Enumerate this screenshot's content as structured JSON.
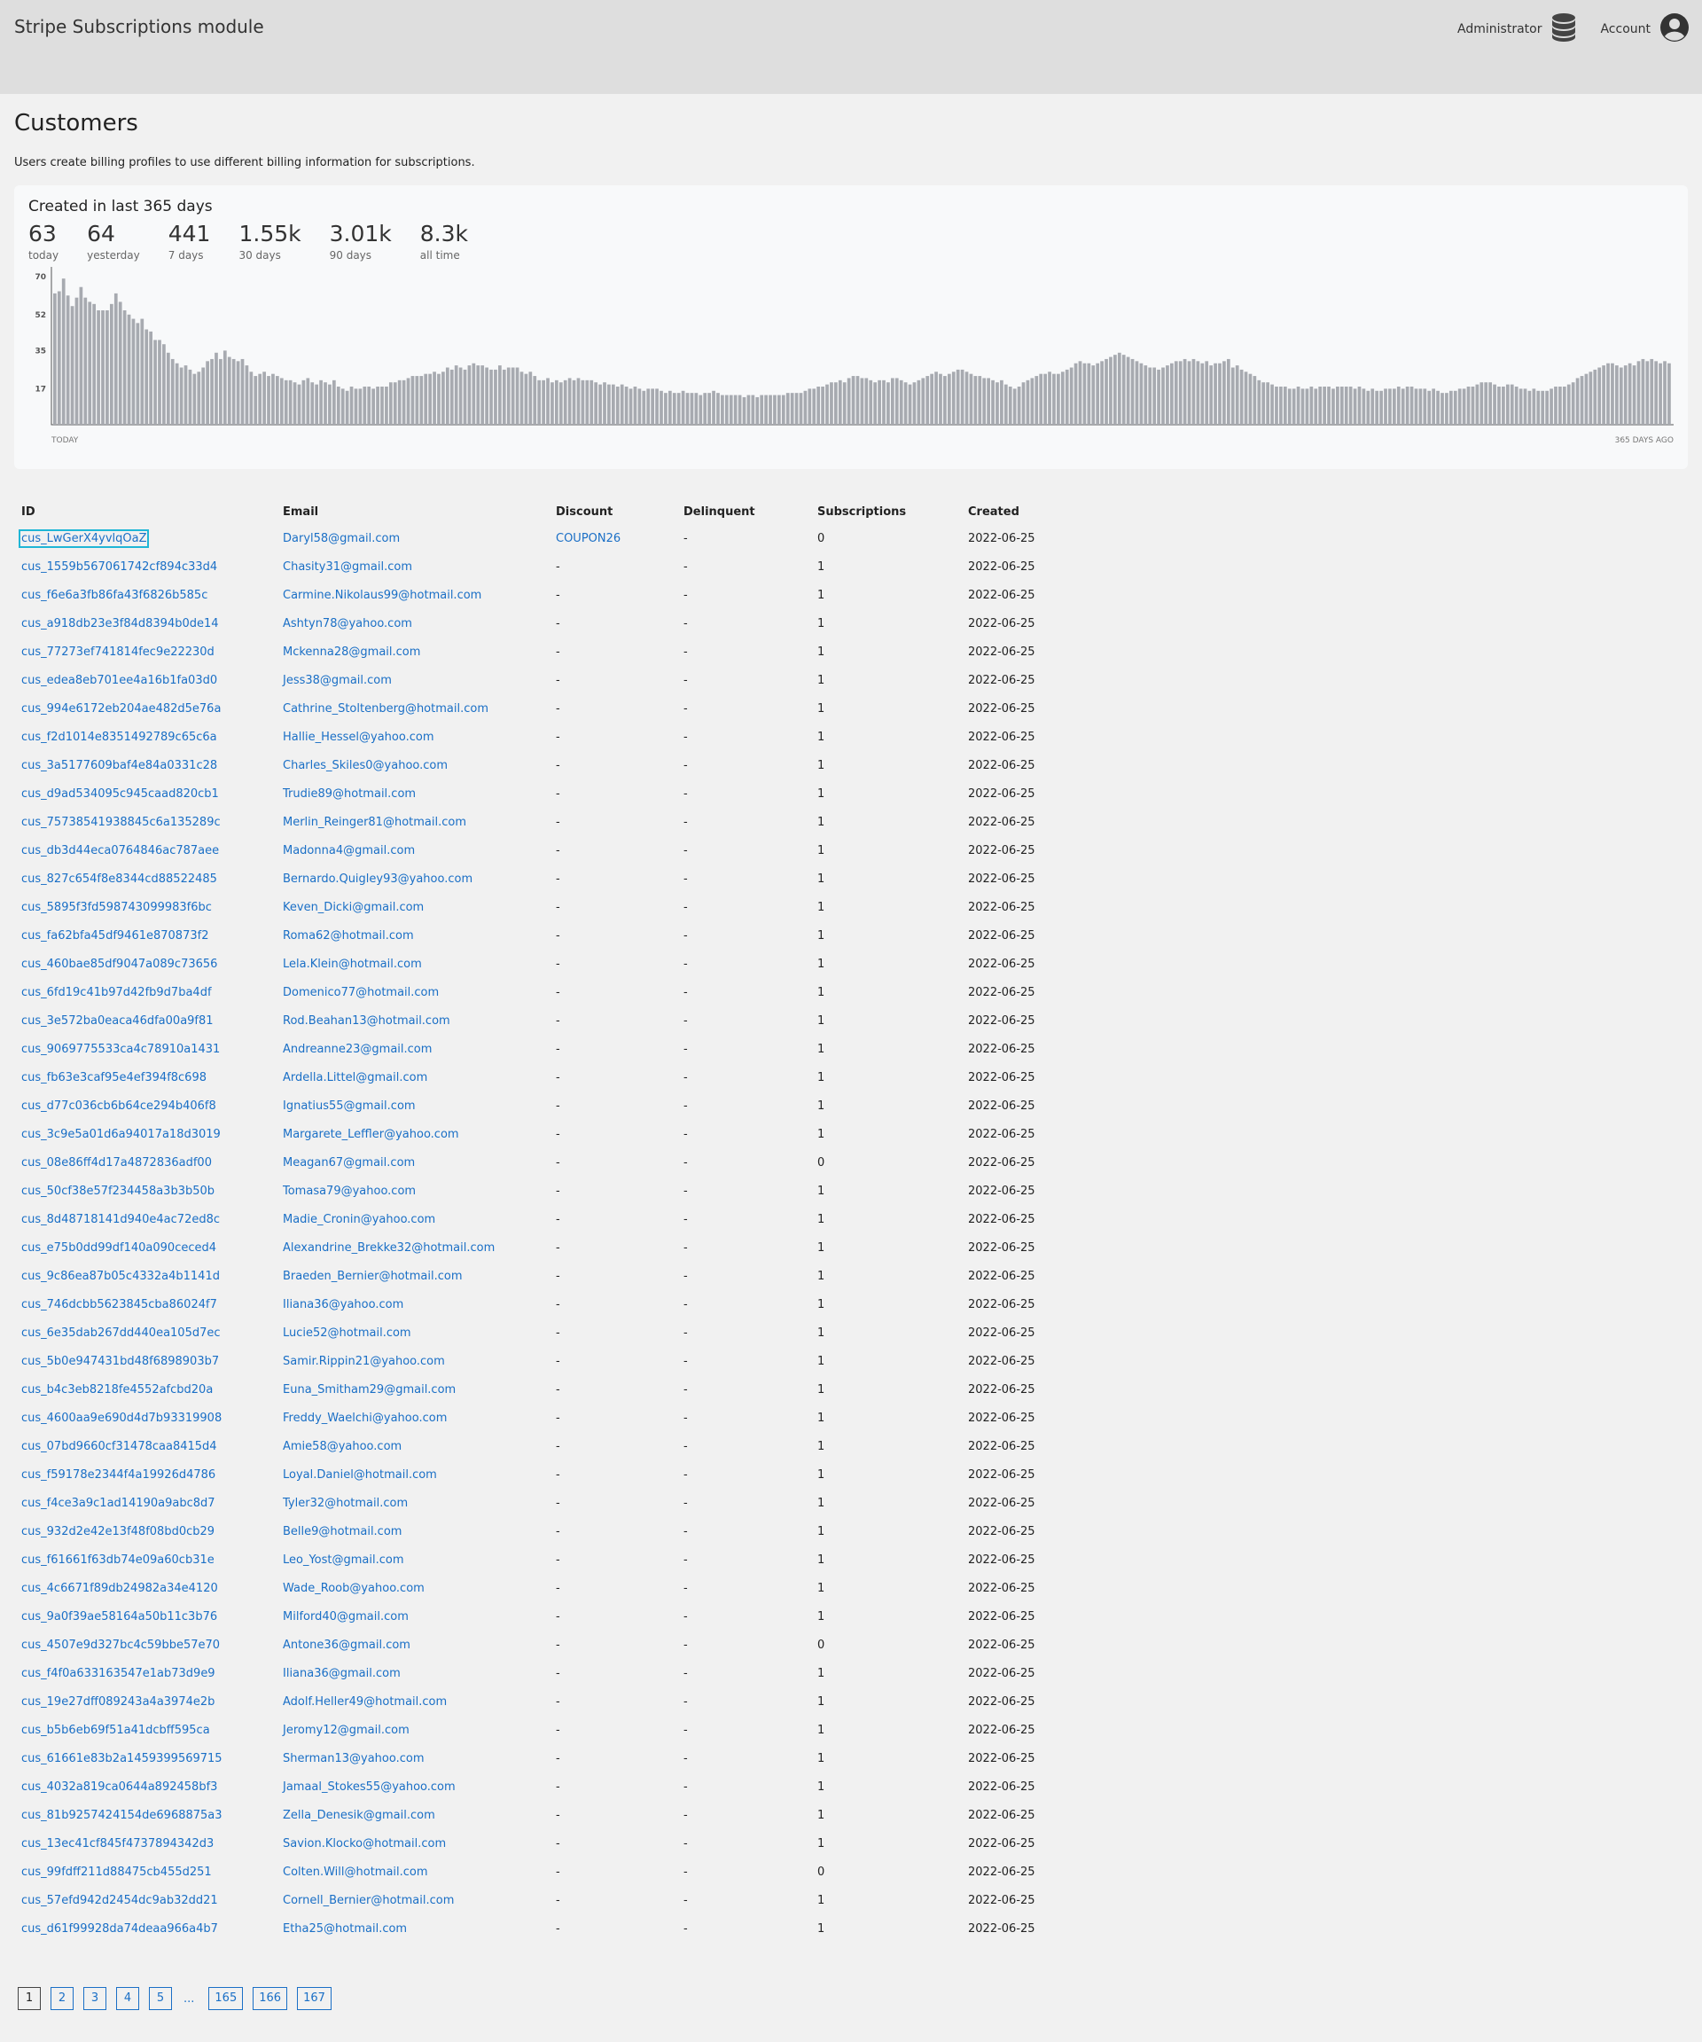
{
  "header": {
    "title": "Stripe Subscriptions module",
    "admin_label": "Administrator",
    "admin_icon": "database-icon",
    "account_label": "Account",
    "account_icon": "user-circle-icon"
  },
  "page": {
    "title": "Customers",
    "description": "Users create billing profiles to use different billing information for subscriptions."
  },
  "stats_card": {
    "title": "Created in last 365 days",
    "stats": [
      {
        "value": "63",
        "label": "today"
      },
      {
        "value": "64",
        "label": "yesterday"
      },
      {
        "value": "441",
        "label": "7 days"
      },
      {
        "value": "1.55k",
        "label": "30 days"
      },
      {
        "value": "3.01k",
        "label": "90 days"
      },
      {
        "value": "8.3k",
        "label": "all time"
      }
    ]
  },
  "chart_data": {
    "type": "bar",
    "title": "",
    "xlabel": "",
    "ylabel": "",
    "x_start_label": "TODAY",
    "x_end_label": "365 DAYS AGO",
    "y_ticks": [
      70,
      52,
      35,
      17
    ],
    "ylim": [
      0,
      72
    ],
    "bar_color": "#a7aab0",
    "values": [
      62,
      63,
      69,
      61,
      56,
      60,
      65,
      60,
      58,
      57,
      54,
      54,
      54,
      57,
      62,
      58,
      54,
      52,
      50,
      48,
      50,
      45,
      44,
      40,
      40,
      38,
      34,
      31,
      29,
      27,
      28,
      26,
      24,
      25,
      27,
      30,
      31,
      34,
      31,
      35,
      32,
      31,
      30,
      31,
      28,
      25,
      23,
      24,
      25,
      23,
      24,
      23,
      22,
      21,
      21,
      20,
      19,
      21,
      22,
      20,
      19,
      21,
      20,
      19,
      21,
      18,
      17,
      16,
      18,
      17,
      17,
      18,
      18,
      17,
      18,
      18,
      18,
      20,
      20,
      21,
      21,
      22,
      23,
      23,
      23,
      24,
      24,
      25,
      24,
      25,
      27,
      26,
      28,
      27,
      26,
      28,
      29,
      28,
      28,
      27,
      26,
      26,
      28,
      26,
      27,
      27,
      27,
      25,
      24,
      25,
      23,
      21,
      21,
      22,
      20,
      21,
      20,
      21,
      22,
      21,
      22,
      21,
      21,
      21,
      20,
      19,
      20,
      19,
      19,
      18,
      19,
      18,
      17,
      18,
      17,
      16,
      17,
      17,
      17,
      16,
      15,
      16,
      15,
      15,
      16,
      15,
      15,
      15,
      14,
      15,
      15,
      16,
      15,
      14,
      14,
      14,
      14,
      14,
      13,
      14,
      14,
      13,
      14,
      14,
      14,
      14,
      14,
      14,
      15,
      15,
      15,
      15,
      16,
      17,
      17,
      18,
      18,
      19,
      20,
      20,
      21,
      20,
      22,
      23,
      23,
      22,
      22,
      21,
      20,
      21,
      21,
      20,
      22,
      22,
      21,
      20,
      19,
      20,
      21,
      22,
      23,
      24,
      25,
      24,
      23,
      24,
      25,
      26,
      26,
      25,
      24,
      23,
      23,
      22,
      22,
      21,
      20,
      21,
      19,
      18,
      17,
      18,
      20,
      21,
      22,
      23,
      24,
      24,
      25,
      24,
      24,
      25,
      26,
      27,
      29,
      30,
      29,
      29,
      28,
      29,
      30,
      31,
      32,
      33,
      34,
      33,
      32,
      31,
      30,
      29,
      28,
      27,
      27,
      26,
      27,
      28,
      29,
      30,
      30,
      31,
      30,
      31,
      30,
      29,
      30,
      28,
      29,
      29,
      30,
      31,
      27,
      28,
      26,
      25,
      24,
      23,
      21,
      20,
      20,
      19,
      18,
      18,
      18,
      17,
      17,
      18,
      17,
      17,
      18,
      17,
      18,
      18,
      18,
      17,
      18,
      18,
      18,
      18,
      17,
      18,
      17,
      16,
      17,
      16,
      16,
      17,
      17,
      17,
      18,
      17,
      18,
      18,
      17,
      17,
      17,
      16,
      17,
      16,
      15,
      15,
      16,
      16,
      17,
      17,
      18,
      18,
      19,
      20,
      20,
      20,
      19,
      18,
      18,
      19,
      19,
      18,
      17,
      17,
      16,
      17,
      16,
      16,
      16,
      17,
      18,
      18,
      18,
      19,
      20,
      22,
      23,
      24,
      25,
      26,
      27,
      28,
      29,
      29,
      28,
      27,
      28,
      29,
      28,
      30,
      31,
      30,
      31,
      30,
      29,
      30,
      29
    ]
  },
  "table": {
    "columns": [
      "ID",
      "Email",
      "Discount",
      "Delinquent",
      "Subscriptions",
      "Created"
    ],
    "rows": [
      [
        "cus_LwGerX4yvlqOaZ",
        "Daryl58@gmail.com",
        "COUPON26",
        "-",
        "0",
        "2022-06-25"
      ],
      [
        "cus_1559b567061742cf894c33d4",
        "Chasity31@gmail.com",
        "-",
        "-",
        "1",
        "2022-06-25"
      ],
      [
        "cus_f6e6a3fb86fa43f6826b585c",
        "Carmine.Nikolaus99@hotmail.com",
        "-",
        "-",
        "1",
        "2022-06-25"
      ],
      [
        "cus_a918db23e3f84d8394b0de14",
        "Ashtyn78@yahoo.com",
        "-",
        "-",
        "1",
        "2022-06-25"
      ],
      [
        "cus_77273ef741814fec9e22230d",
        "Mckenna28@gmail.com",
        "-",
        "-",
        "1",
        "2022-06-25"
      ],
      [
        "cus_edea8eb701ee4a16b1fa03d0",
        "Jess38@gmail.com",
        "-",
        "-",
        "1",
        "2022-06-25"
      ],
      [
        "cus_994e6172eb204ae482d5e76a",
        "Cathrine_Stoltenberg@hotmail.com",
        "-",
        "-",
        "1",
        "2022-06-25"
      ],
      [
        "cus_f2d1014e8351492789c65c6a",
        "Hallie_Hessel@yahoo.com",
        "-",
        "-",
        "1",
        "2022-06-25"
      ],
      [
        "cus_3a5177609baf4e84a0331c28",
        "Charles_Skiles0@yahoo.com",
        "-",
        "-",
        "1",
        "2022-06-25"
      ],
      [
        "cus_d9ad534095c945caad820cb1",
        "Trudie89@hotmail.com",
        "-",
        "-",
        "1",
        "2022-06-25"
      ],
      [
        "cus_75738541938845c6a135289c",
        "Merlin_Reinger81@hotmail.com",
        "-",
        "-",
        "1",
        "2022-06-25"
      ],
      [
        "cus_db3d44eca0764846ac787aee",
        "Madonna4@gmail.com",
        "-",
        "-",
        "1",
        "2022-06-25"
      ],
      [
        "cus_827c654f8e8344cd88522485",
        "Bernardo.Quigley93@yahoo.com",
        "-",
        "-",
        "1",
        "2022-06-25"
      ],
      [
        "cus_5895f3fd598743099983f6bc",
        "Keven_Dicki@gmail.com",
        "-",
        "-",
        "1",
        "2022-06-25"
      ],
      [
        "cus_fa62bfa45df9461e870873f2",
        "Roma62@hotmail.com",
        "-",
        "-",
        "1",
        "2022-06-25"
      ],
      [
        "cus_460bae85df9047a089c73656",
        "Lela.Klein@hotmail.com",
        "-",
        "-",
        "1",
        "2022-06-25"
      ],
      [
        "cus_6fd19c41b97d42fb9d7ba4df",
        "Domenico77@hotmail.com",
        "-",
        "-",
        "1",
        "2022-06-25"
      ],
      [
        "cus_3e572ba0eaca46dfa00a9f81",
        "Rod.Beahan13@hotmail.com",
        "-",
        "-",
        "1",
        "2022-06-25"
      ],
      [
        "cus_9069775533ca4c78910a1431",
        "Andreanne23@gmail.com",
        "-",
        "-",
        "1",
        "2022-06-25"
      ],
      [
        "cus_fb63e3caf95e4ef394f8c698",
        "Ardella.Littel@gmail.com",
        "-",
        "-",
        "1",
        "2022-06-25"
      ],
      [
        "cus_d77c036cb6b64ce294b406f8",
        "Ignatius55@gmail.com",
        "-",
        "-",
        "1",
        "2022-06-25"
      ],
      [
        "cus_3c9e5a01d6a94017a18d3019",
        "Margarete_Leffler@yahoo.com",
        "-",
        "-",
        "1",
        "2022-06-25"
      ],
      [
        "cus_08e86ff4d17a4872836adf00",
        "Meagan67@gmail.com",
        "-",
        "-",
        "0",
        "2022-06-25"
      ],
      [
        "cus_50cf38e57f234458a3b3b50b",
        "Tomasa79@yahoo.com",
        "-",
        "-",
        "1",
        "2022-06-25"
      ],
      [
        "cus_8d48718141d940e4ac72ed8c",
        "Madie_Cronin@yahoo.com",
        "-",
        "-",
        "1",
        "2022-06-25"
      ],
      [
        "cus_e75b0dd99df140a090ceced4",
        "Alexandrine_Brekke32@hotmail.com",
        "-",
        "-",
        "1",
        "2022-06-25"
      ],
      [
        "cus_9c86ea87b05c4332a4b1141d",
        "Braeden_Bernier@hotmail.com",
        "-",
        "-",
        "1",
        "2022-06-25"
      ],
      [
        "cus_746dcbb5623845cba86024f7",
        "Iliana36@yahoo.com",
        "-",
        "-",
        "1",
        "2022-06-25"
      ],
      [
        "cus_6e35dab267dd440ea105d7ec",
        "Lucie52@hotmail.com",
        "-",
        "-",
        "1",
        "2022-06-25"
      ],
      [
        "cus_5b0e947431bd48f6898903b7",
        "Samir.Rippin21@yahoo.com",
        "-",
        "-",
        "1",
        "2022-06-25"
      ],
      [
        "cus_b4c3eb8218fe4552afcbd20a",
        "Euna_Smitham29@gmail.com",
        "-",
        "-",
        "1",
        "2022-06-25"
      ],
      [
        "cus_4600aa9e690d4d7b93319908",
        "Freddy_Waelchi@yahoo.com",
        "-",
        "-",
        "1",
        "2022-06-25"
      ],
      [
        "cus_07bd9660cf31478caa8415d4",
        "Amie58@yahoo.com",
        "-",
        "-",
        "1",
        "2022-06-25"
      ],
      [
        "cus_f59178e2344f4a19926d4786",
        "Loyal.Daniel@hotmail.com",
        "-",
        "-",
        "1",
        "2022-06-25"
      ],
      [
        "cus_f4ce3a9c1ad14190a9abc8d7",
        "Tyler32@hotmail.com",
        "-",
        "-",
        "1",
        "2022-06-25"
      ],
      [
        "cus_932d2e42e13f48f08bd0cb29",
        "Belle9@hotmail.com",
        "-",
        "-",
        "1",
        "2022-06-25"
      ],
      [
        "cus_f61661f63db74e09a60cb31e",
        "Leo_Yost@gmail.com",
        "-",
        "-",
        "1",
        "2022-06-25"
      ],
      [
        "cus_4c6671f89db24982a34e4120",
        "Wade_Roob@yahoo.com",
        "-",
        "-",
        "1",
        "2022-06-25"
      ],
      [
        "cus_9a0f39ae58164a50b11c3b76",
        "Milford40@gmail.com",
        "-",
        "-",
        "1",
        "2022-06-25"
      ],
      [
        "cus_4507e9d327bc4c59bbe57e70",
        "Antone36@gmail.com",
        "-",
        "-",
        "0",
        "2022-06-25"
      ],
      [
        "cus_f4f0a633163547e1ab73d9e9",
        "Iliana36@gmail.com",
        "-",
        "-",
        "1",
        "2022-06-25"
      ],
      [
        "cus_19e27dff089243a4a3974e2b",
        "Adolf.Heller49@hotmail.com",
        "-",
        "-",
        "1",
        "2022-06-25"
      ],
      [
        "cus_b5b6eb69f51a41dcbff595ca",
        "Jeromy12@gmail.com",
        "-",
        "-",
        "1",
        "2022-06-25"
      ],
      [
        "cus_61661e83b2a1459399569715",
        "Sherman13@yahoo.com",
        "-",
        "-",
        "1",
        "2022-06-25"
      ],
      [
        "cus_4032a819ca0644a892458bf3",
        "Jamaal_Stokes55@yahoo.com",
        "-",
        "-",
        "1",
        "2022-06-25"
      ],
      [
        "cus_81b9257424154de6968875a3",
        "Zella_Denesik@gmail.com",
        "-",
        "-",
        "1",
        "2022-06-25"
      ],
      [
        "cus_13ec41cf845f4737894342d3",
        "Savion.Klocko@hotmail.com",
        "-",
        "-",
        "1",
        "2022-06-25"
      ],
      [
        "cus_99fdff211d88475cb455d251",
        "Colten.Will@hotmail.com",
        "-",
        "-",
        "0",
        "2022-06-25"
      ],
      [
        "cus_57efd942d2454dc9ab32dd21",
        "Cornell_Bernier@hotmail.com",
        "-",
        "-",
        "1",
        "2022-06-25"
      ],
      [
        "cus_d61f99928da74deaa966a4b7",
        "Etha25@hotmail.com",
        "-",
        "-",
        "1",
        "2022-06-25"
      ]
    ]
  },
  "pagination": {
    "current": "1",
    "pages_before": [
      "2",
      "3",
      "4",
      "5"
    ],
    "ellipsis": "...",
    "pages_after": [
      "165",
      "166",
      "167"
    ]
  }
}
